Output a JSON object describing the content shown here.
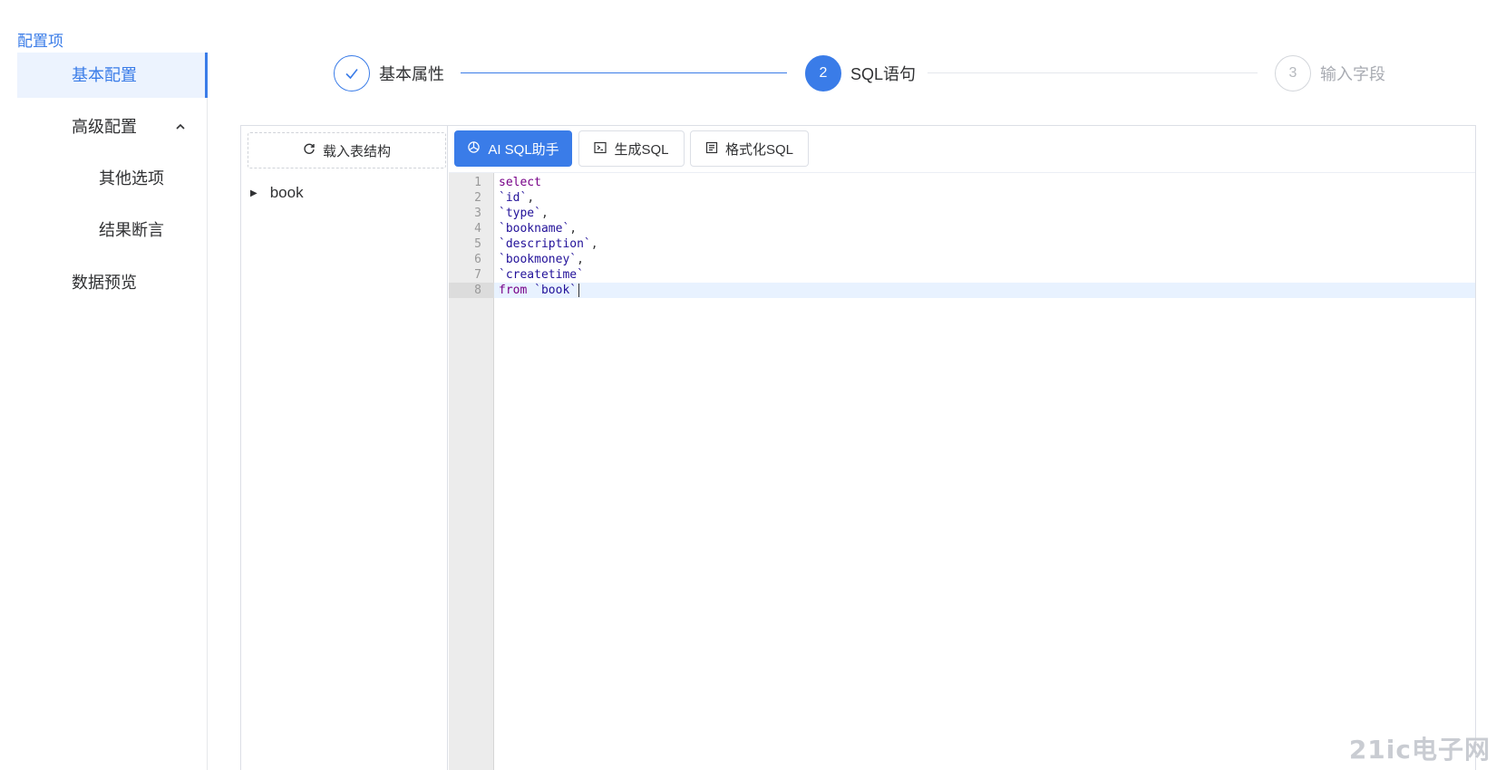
{
  "sidebar": {
    "title": "配置项",
    "items": [
      {
        "label": "基本配置",
        "active": true
      },
      {
        "label": "高级配置",
        "expanded": true
      },
      {
        "label": "其他选项",
        "sub": true
      },
      {
        "label": "结果断言",
        "sub": true
      },
      {
        "label": "数据预览"
      }
    ]
  },
  "steps": [
    {
      "index": "1",
      "label": "基本属性",
      "status": "done",
      "icon": "check-icon"
    },
    {
      "index": "2",
      "label": "SQL语句",
      "status": "active"
    },
    {
      "index": "3",
      "label": "输入字段",
      "status": "wait"
    }
  ],
  "left_pane": {
    "load_button": "载入表结构",
    "load_icon": "refresh-icon",
    "tree": [
      {
        "label": "book"
      }
    ]
  },
  "toolbar": {
    "ai_button": "AI SQL助手",
    "ai_icon": "openai-icon",
    "generate_button": "生成SQL",
    "generate_icon": "terminal-icon",
    "format_button": "格式化SQL",
    "format_icon": "document-icon"
  },
  "editor": {
    "active_line": 8,
    "lines": [
      {
        "n": "1",
        "text": "select"
      },
      {
        "n": "2",
        "text": "`id`,"
      },
      {
        "n": "3",
        "text": "`type`,"
      },
      {
        "n": "4",
        "text": "`bookname`,"
      },
      {
        "n": "5",
        "text": "`description`,"
      },
      {
        "n": "6",
        "text": "`bookmoney`,"
      },
      {
        "n": "7",
        "text": "`createtime`"
      },
      {
        "n": "8",
        "text": "from `book`"
      }
    ]
  },
  "colors": {
    "accent": "#3a7ce8",
    "keyword": "#770088",
    "identifier": "#221199"
  },
  "watermark": "21ic电子网"
}
